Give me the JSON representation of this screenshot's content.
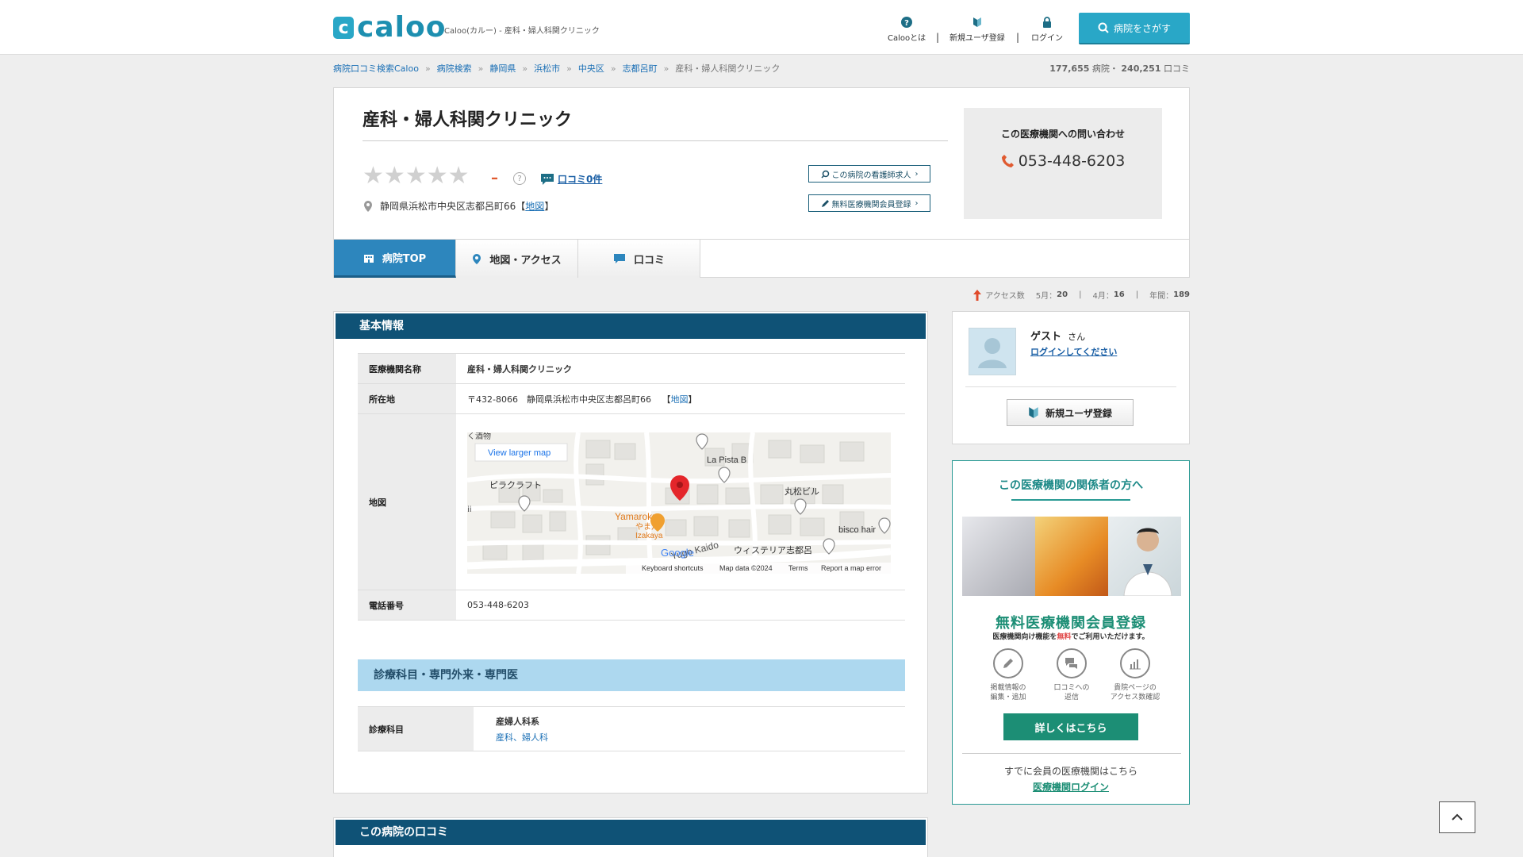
{
  "header": {
    "logo_mark": "c",
    "logo_text": "caloo",
    "logo_sub": "Caloo(カルー) - 産科・婦人科関クリニック",
    "nav": [
      {
        "label": "Calooとは",
        "icon": "question-icon"
      },
      {
        "label": "新規ユーザ登録",
        "icon": "beginner-icon"
      },
      {
        "label": "ログイン",
        "icon": "lock-icon"
      }
    ],
    "separator": "|",
    "search_label": "病院をさがす"
  },
  "breadcrumb": {
    "items": [
      "病院口コミ検索Caloo",
      "病院検索",
      "静岡県",
      "浜松市",
      "中央区",
      "志都呂町"
    ],
    "current": "産科・婦人科関クリニック",
    "sep": "»"
  },
  "counts": {
    "hospitals": "177,655",
    "hospitals_unit": "病院・",
    "reviews": "240,251",
    "reviews_unit": "口コミ"
  },
  "clinic": {
    "name": "産科・婦人科関クリニック",
    "rating_dash": "–",
    "help": "?",
    "review_link": "口コミ0件",
    "rating_value": 0,
    "rating_max": 5,
    "address": "静岡県浜松市中央区志都呂町66",
    "address_map_open": "【",
    "address_map_link": "地図",
    "address_map_close": "】",
    "btn_nurse": "この病院の看護師求人",
    "btn_member": "無料医療機関会員登録"
  },
  "contact": {
    "label": "この医療機関への問い合わせ",
    "phone": "053-448-6203"
  },
  "tabs": [
    {
      "label": "病院TOP",
      "active": true
    },
    {
      "label": "地図・アクセス",
      "active": false
    },
    {
      "label": "口コミ",
      "active": false
    }
  ],
  "access": {
    "label": "アクセス数",
    "may_label": "5月：",
    "may": "20",
    "apr_label": "4月：",
    "apr": "16",
    "year_label": "年間：",
    "year": "189",
    "sep": "|"
  },
  "basic": {
    "heading": "基本情報",
    "rows": [
      {
        "key": "医療機関名称",
        "value": "産科・婦人科関クリニック"
      },
      {
        "key": "所在地",
        "value": "〒432-8066　静岡県浜松市中央区志都呂町66",
        "map_open": "【",
        "map_link": "地図",
        "map_close": "】"
      },
      {
        "key": "地図"
      },
      {
        "key": "電話番号",
        "value": "053-448-6203"
      }
    ]
  },
  "map": {
    "view_larger": "View larger map",
    "labels": [
      "La Pista B",
      "丸松ビル",
      "ピラクラフト",
      "Yamaroku",
      "やま六",
      "Izakaya",
      "bisco hair",
      "ウィステリア志都呂",
      "Yugo Kaido",
      "Google"
    ],
    "footer": [
      "Keyboard shortcuts",
      "Map data ©2024",
      "Terms",
      "Report a map error"
    ],
    "edge_top": "く酒物",
    "edge_left": "ii"
  },
  "departments": {
    "heading": "診療科目・専門外来・専門医",
    "key": "診療科目",
    "category": "産婦人科系",
    "items": "産科、婦人科"
  },
  "user": {
    "name": "ゲスト",
    "suffix": "さん",
    "login_link": "ログインしてください",
    "register": "新規ユーザ登録"
  },
  "pro": {
    "title": "この医療機関の関係者の方へ",
    "big": "無料医療機関会員登録",
    "small_pre": "医療機関向け機能を",
    "small_red": "無料",
    "small_post": "でご利用いただけます。",
    "features": [
      {
        "l1": "掲載情報の",
        "l2": "編集・追加",
        "icon": "pencil-icon"
      },
      {
        "l1": "口コミへの",
        "l2": "返信",
        "icon": "chat-icon"
      },
      {
        "l1": "貴院ページの",
        "l2": "アクセス数確認",
        "icon": "chart-icon"
      }
    ],
    "details": "詳しくはこちら",
    "member": "すでに会員の医療機関はこちら",
    "member_link": "医療機関ログイン"
  },
  "reviews": {
    "heading": "この病院の口コミ"
  },
  "colors": {
    "brand": "#29a7c7",
    "navy": "#0f5276",
    "tab_active": "#2d86bd",
    "pro_green": "#1c8e75"
  }
}
